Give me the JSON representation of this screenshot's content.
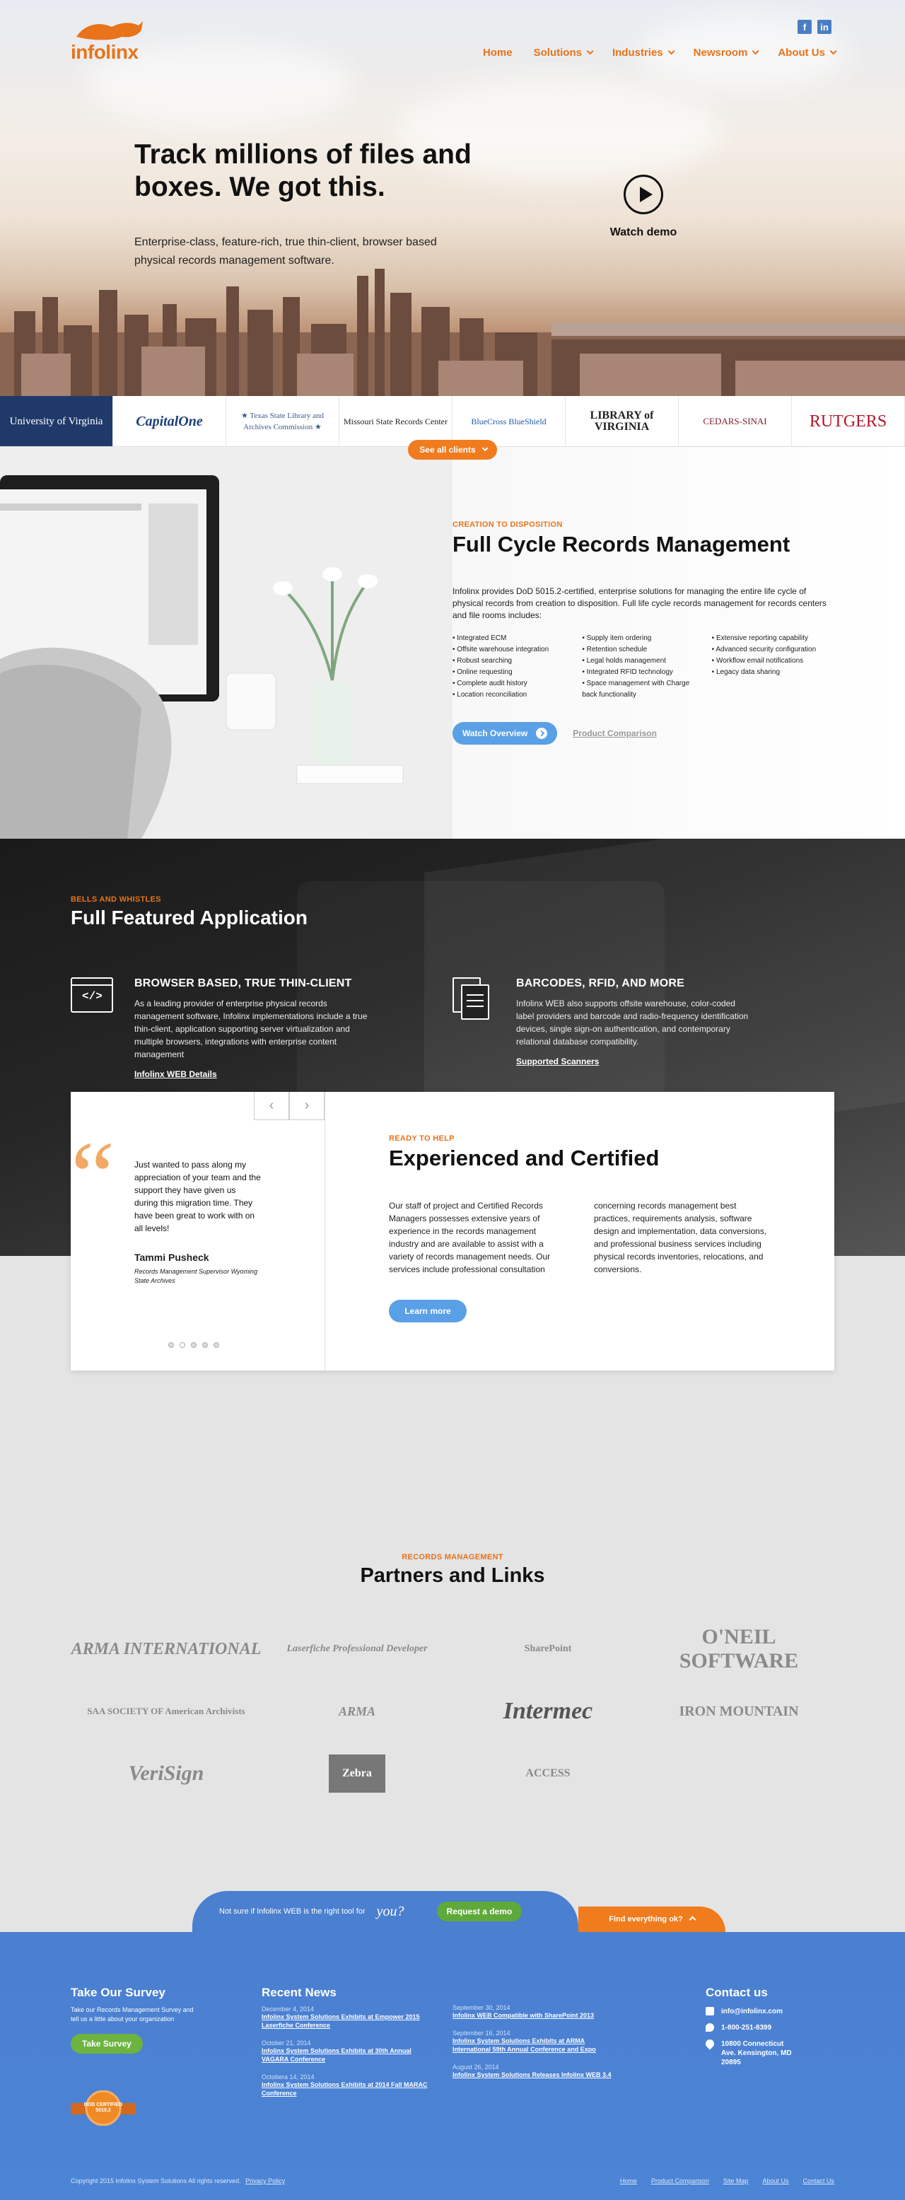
{
  "brand": {
    "name": "infolinx",
    "accent": "#e8731a"
  },
  "social": [
    {
      "icon": "facebook-icon",
      "glyph": "f"
    },
    {
      "icon": "linkedin-icon",
      "glyph": "in"
    }
  ],
  "nav": [
    {
      "label": "Home",
      "dropdown": false
    },
    {
      "label": "Solutions",
      "dropdown": true
    },
    {
      "label": "Industries",
      "dropdown": true
    },
    {
      "label": "Newsroom",
      "dropdown": true
    },
    {
      "label": "About Us",
      "dropdown": true
    }
  ],
  "hero": {
    "title": "Track millions of files and boxes. We got this.",
    "subtitle": "Enterprise-class, feature-rich, true thin-client, browser based physical records management software.",
    "watch_demo": "Watch demo"
  },
  "clients": {
    "logos": [
      "University of Virginia",
      "CapitalOne",
      "★ Texas State Library and Archives Commission ★",
      "Missouri State Records Center",
      "BlueCross BlueShield",
      "LIBRARY of VIRGINIA",
      "CEDARS-SINAI",
      "RUTGERS"
    ],
    "see_all": "See all clients"
  },
  "full_cycle": {
    "eyebrow": "CREATION TO DISPOSITION",
    "title": "Full Cycle Records Management",
    "description": "Infolinx provides DoD 5015.2-certified, enterprise solutions for managing the entire life cycle of physical records from creation to disposition. Full life cycle records management for records centers and file rooms includes:",
    "features": [
      [
        "Integrated ECM",
        "Offsite warehouse integration",
        "Robust searching",
        "Online requesting",
        "Complete audit history",
        "Location reconciliation"
      ],
      [
        "Supply item ordering",
        "Retention schedule",
        "Legal holds management",
        "Integrated RFID technology",
        "Space management with Charge back functionality"
      ],
      [
        "Extensive reporting capability",
        "Advanced security configuration",
        "Workflow email notifications",
        "Legacy data sharing"
      ]
    ],
    "watch_overview": "Watch Overview",
    "product_comparison": "Product Comparison"
  },
  "application": {
    "eyebrow": "BELLS AND WHISTLES",
    "title": "Full Featured Application",
    "features": [
      {
        "title": "BROWSER BASED, TRUE THIN-CLIENT",
        "description": "As a leading provider of enterprise physical records management software, Infolinx implementations include a true thin-client, application supporting server virtualization and multiple browsers, integrations with enterprise content management",
        "link": "Infolinx WEB Details",
        "icon": "code-window-icon"
      },
      {
        "title": "BARCODES, RFID, AND MORE",
        "description": "Infolinx WEB also supports offsite warehouse, color-coded label providers and barcode and radio-frequency identification devices, single sign-on authentication, and contemporary relational database compatibility.",
        "link": "Supported Scanners",
        "icon": "documents-icon"
      }
    ]
  },
  "testimonial": {
    "quote": "Just wanted to pass along my appreciation of your team and the support they have given us during this migration time. They have been great to work with on all levels!",
    "name": "Tammi Pusheck",
    "role": "Records Management Supervisor Wyoming State Archives",
    "active_dot": 2,
    "dot_count": 5
  },
  "certified": {
    "eyebrow": "READY TO HELP",
    "title": "Experienced and Certified",
    "col1": "Our staff of project and Certified Records Managers possesses extensive years of experience in the records management industry and are available to assist with a variety of records management needs. Our services include professional consultation",
    "col2": "concerning records management best practices, requirements analysis, software design and implementation, data conversions, and professional business services including physical records inventories, relocations, and conversions.",
    "learn_more": "Learn more"
  },
  "partners": {
    "eyebrow": "RECORDS MANAGEMENT",
    "title": "Partners and Links",
    "logos": [
      "ARMA INTERNATIONAL",
      "Laserfiche Professional Developer",
      "SharePoint",
      "O'NEIL SOFTWARE",
      "SAA SOCIETY OF American Archivists",
      "ARMA",
      "Intermec",
      "IRON MOUNTAIN",
      "VeriSign",
      "Zebra",
      "ACCESS"
    ]
  },
  "cta": {
    "prompt": "Not sure if Infolinx WEB is the right tool for",
    "you": "you?",
    "request": "Request a demo",
    "found": "Find everything ok?"
  },
  "footer": {
    "survey": {
      "title": "Take Our Survey",
      "text": "Take our Records Management Survey and tell us a little about your organization",
      "button": "Take Survey",
      "badge": "DOD CERTIFIED 5015.2"
    },
    "news_title": "Recent News",
    "news": [
      [
        {
          "date": "December 4, 2014",
          "title": "Infolinx System Solutions Exhibits at Empower 2015 Laserfiche Conference"
        },
        {
          "date": "October 21, 2014",
          "title": "Infolinx System Solutions Exhibits at 30th Annual VAGARA Conference"
        },
        {
          "date": "Octobera 14, 2014",
          "title": "Infolinx System Solutions Exhibits at 2014 Fall MARAC Conference"
        }
      ],
      [
        {
          "date": "September 30, 2014",
          "title": "Infolinx WEB Compatible with SharePoint 2013"
        },
        {
          "date": "September 16, 2014",
          "title": "Infolinx System Solutions Exhibits at ARMA International 59th Annual Conference and Expo"
        },
        {
          "date": "August 26, 2014",
          "title": "Infolinx System Solutions Releases Infolinx WEB 3.4"
        }
      ]
    ],
    "contact": {
      "title": "Contact us",
      "email": "info@infolinx.com",
      "phone": "1-800-251-8399",
      "address": "10800 Connecticut Ave. Kensington, MD 20895"
    },
    "copyright": "Copyright 2015 Infolinx System Solutions All rights reserved.",
    "privacy": "Privacy Policy",
    "links": [
      "Home",
      "Product Comparison",
      "Site Map",
      "About Us",
      "Contact Us"
    ]
  }
}
